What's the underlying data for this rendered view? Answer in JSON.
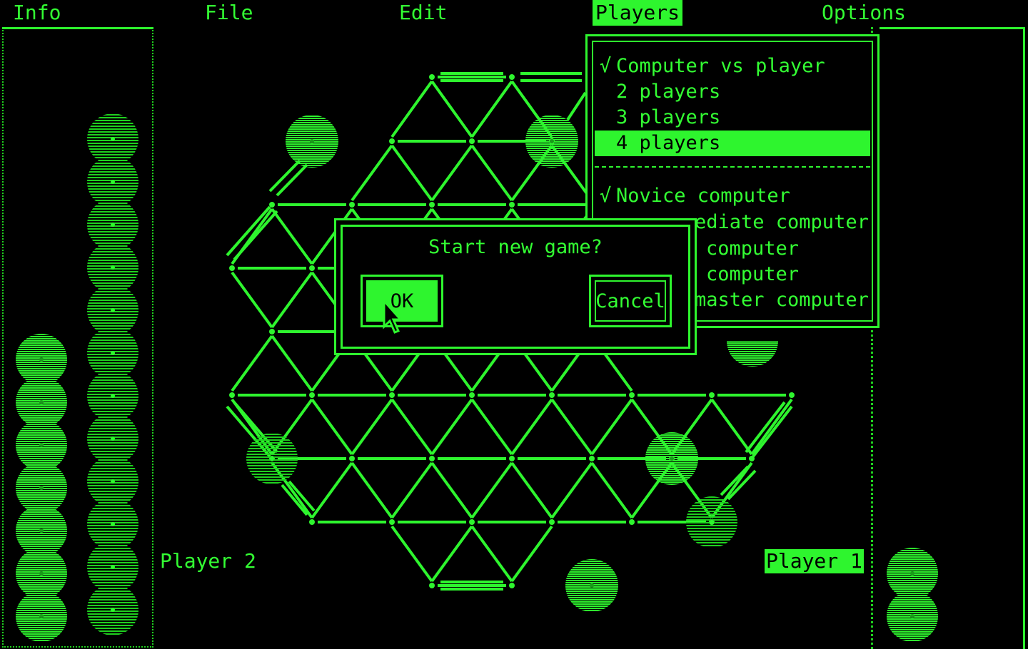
{
  "menubar": {
    "items": [
      {
        "label": "Info",
        "active": false
      },
      {
        "label": "File",
        "active": false
      },
      {
        "label": "Edit",
        "active": false
      },
      {
        "label": "Players",
        "active": true
      },
      {
        "label": "Options",
        "active": false
      }
    ]
  },
  "players_menu": {
    "items": [
      {
        "label": "Computer vs player",
        "checked": true,
        "highlighted": false
      },
      {
        "label": "2 players",
        "checked": false,
        "highlighted": false
      },
      {
        "label": "3 players",
        "checked": false,
        "highlighted": false
      },
      {
        "label": "4 players",
        "checked": false,
        "highlighted": true
      }
    ],
    "level_items": [
      {
        "label": "Novice computer",
        "checked": true
      },
      {
        "label": "ediate computer",
        "checked": false
      },
      {
        "label": "computer",
        "checked": false
      },
      {
        "label": "computer",
        "checked": false
      },
      {
        "label": "master computer",
        "checked": false
      }
    ],
    "check_glyph": "√"
  },
  "dialog": {
    "message": "Start new game?",
    "ok_label": "OK",
    "cancel_label": "Cancel"
  },
  "players": {
    "player2_label": "Player 2",
    "player1_label": "Player 1",
    "current": "Player 1"
  },
  "pieces": {
    "left_solid_count": 7,
    "left_striped_count": 12,
    "right_solid_count": 2
  },
  "colors": {
    "phosphor": "#2ef52e",
    "background": "#000000"
  },
  "icons": {
    "cursor": "arrow-cursor-icon",
    "check": "check-icon"
  }
}
